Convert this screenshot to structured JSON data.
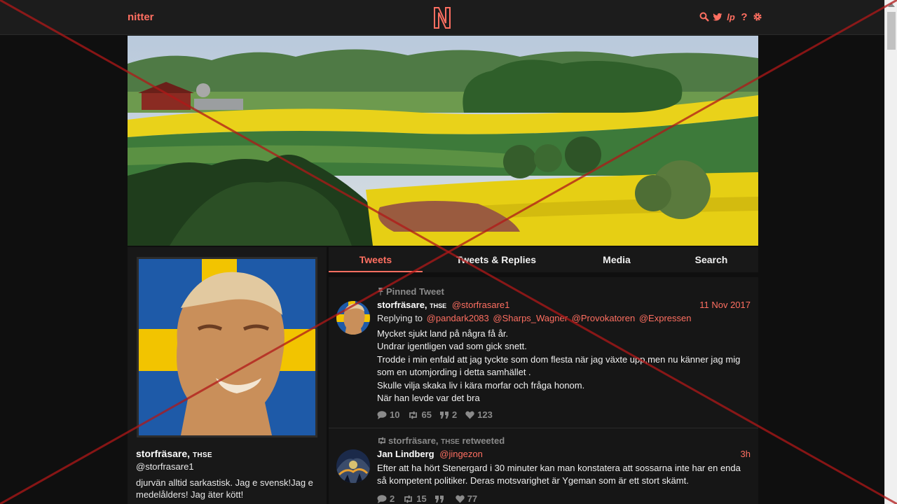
{
  "nav": {
    "brand": "nitter",
    "logo_letter": "N",
    "icons": [
      "search-icon",
      "twitter-icon",
      "liberapay-icon",
      "help-icon",
      "gear-icon"
    ]
  },
  "banner": {
    "description": "rapeseed fields landscape"
  },
  "profile": {
    "fullname": "storfräsare,",
    "affiliation": "THSE",
    "username": "@storfrasare1",
    "bio": "djurvän alltid sarkastisk. Jag e svensk!Jag e medelålders! Jag äter kött!"
  },
  "tabs": [
    {
      "label": "Tweets",
      "active": true
    },
    {
      "label": "Tweets & Replies",
      "active": false
    },
    {
      "label": "Media",
      "active": false
    },
    {
      "label": "Search",
      "active": false
    }
  ],
  "tweets": [
    {
      "note": "Pinned Tweet",
      "fullname": "storfräsare,",
      "affiliation": "THSE",
      "handle": "@storfrasare1",
      "date": "11 Nov 2017",
      "replying_prefix": "Replying to",
      "replying_to": [
        "@pandark2083",
        "@Sharps_Wagner",
        "@Provokatoren",
        "@Expressen"
      ],
      "body_lines": [
        "Mycket sjukt land på några få år.",
        "Undrar igentligen vad som gick snett.",
        "Trodde i min enfald att jag tyckte som dom flesta när jag växte upp,men nu känner jag mig som en utomjording i detta samhället .",
        "Skulle vilja skaka liv i kära morfar och fråga honom.",
        "När han levde var det bra"
      ],
      "stats": {
        "replies": "10",
        "retweets": "65",
        "quotes": "2",
        "likes": "123"
      }
    },
    {
      "note_name": "storfräsare,",
      "note_affiliation": "THSE",
      "note_suffix": "retweeted",
      "fullname": "Jan Lindberg",
      "handle": "@jingezon",
      "date": "3h",
      "body": "Efter att ha hört Stenergard i 30 minuter kan man konstatera att sossarna inte har en enda så kompetent politiker. Deras motsvarighet är Ygeman som är ett stort skämt.",
      "stats": {
        "replies": "2",
        "retweets": "15",
        "quotes": "",
        "likes": "77"
      }
    }
  ],
  "colors": {
    "accent": "#ff6f61",
    "background": "#0f0f0f",
    "panel": "#181818",
    "muted": "#8a8a8a"
  }
}
